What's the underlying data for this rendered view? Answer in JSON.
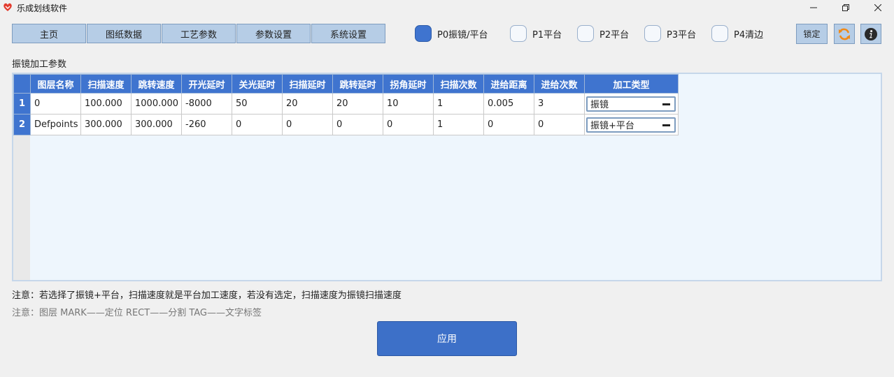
{
  "window": {
    "title": "乐成划线软件",
    "icons": {
      "logo": "app-logo-icon",
      "minimize": "minimize-icon",
      "maximize": "restore-icon",
      "close": "close-icon"
    }
  },
  "nav": {
    "tabs": [
      {
        "label": "主页"
      },
      {
        "label": "图纸数据"
      },
      {
        "label": "工艺参数"
      },
      {
        "label": "参数设置"
      },
      {
        "label": "系统设置"
      }
    ]
  },
  "platforms": [
    {
      "label": "P0振镜/平台",
      "checked": true
    },
    {
      "label": "P1平台",
      "checked": false
    },
    {
      "label": "P2平台",
      "checked": false
    },
    {
      "label": "P3平台",
      "checked": false
    },
    {
      "label": "P4清边",
      "checked": false
    }
  ],
  "toolbar": {
    "lock_label": "锁定",
    "refresh_icon": "refresh-icon",
    "info_icon": "info-icon"
  },
  "section": {
    "title": "振镜加工参数"
  },
  "table": {
    "columns": [
      "图层名称",
      "扫描速度",
      "跳转速度",
      "开光延时",
      "关光延时",
      "扫描延时",
      "跳转延时",
      "拐角延时",
      "扫描次数",
      "进给距离",
      "进给次数",
      "加工类型"
    ],
    "rows": [
      {
        "num": "1",
        "cells": [
          "0",
          "100.000",
          "1000.000",
          "-8000",
          "50",
          "20",
          "20",
          "10",
          "1",
          "0.005",
          "3"
        ],
        "type": "振镜"
      },
      {
        "num": "2",
        "cells": [
          "Defpoints",
          "300.000",
          "300.000",
          "-260",
          "0",
          "0",
          "0",
          "0",
          "1",
          "0",
          "0"
        ],
        "type": "振镜+平台"
      }
    ]
  },
  "notes": {
    "note1": "注意：若选择了振镜+平台，扫描速度就是平台加工速度，若没有选定，扫描速度为振镜扫描速度",
    "note2": "注意：图层 MARK——定位  RECT——分割  TAG——文字标签"
  },
  "apply_label": "应用",
  "colors": {
    "accent": "#3f74cf",
    "nav_bg": "#b6cde6",
    "table_bg": "#eef6fd"
  }
}
